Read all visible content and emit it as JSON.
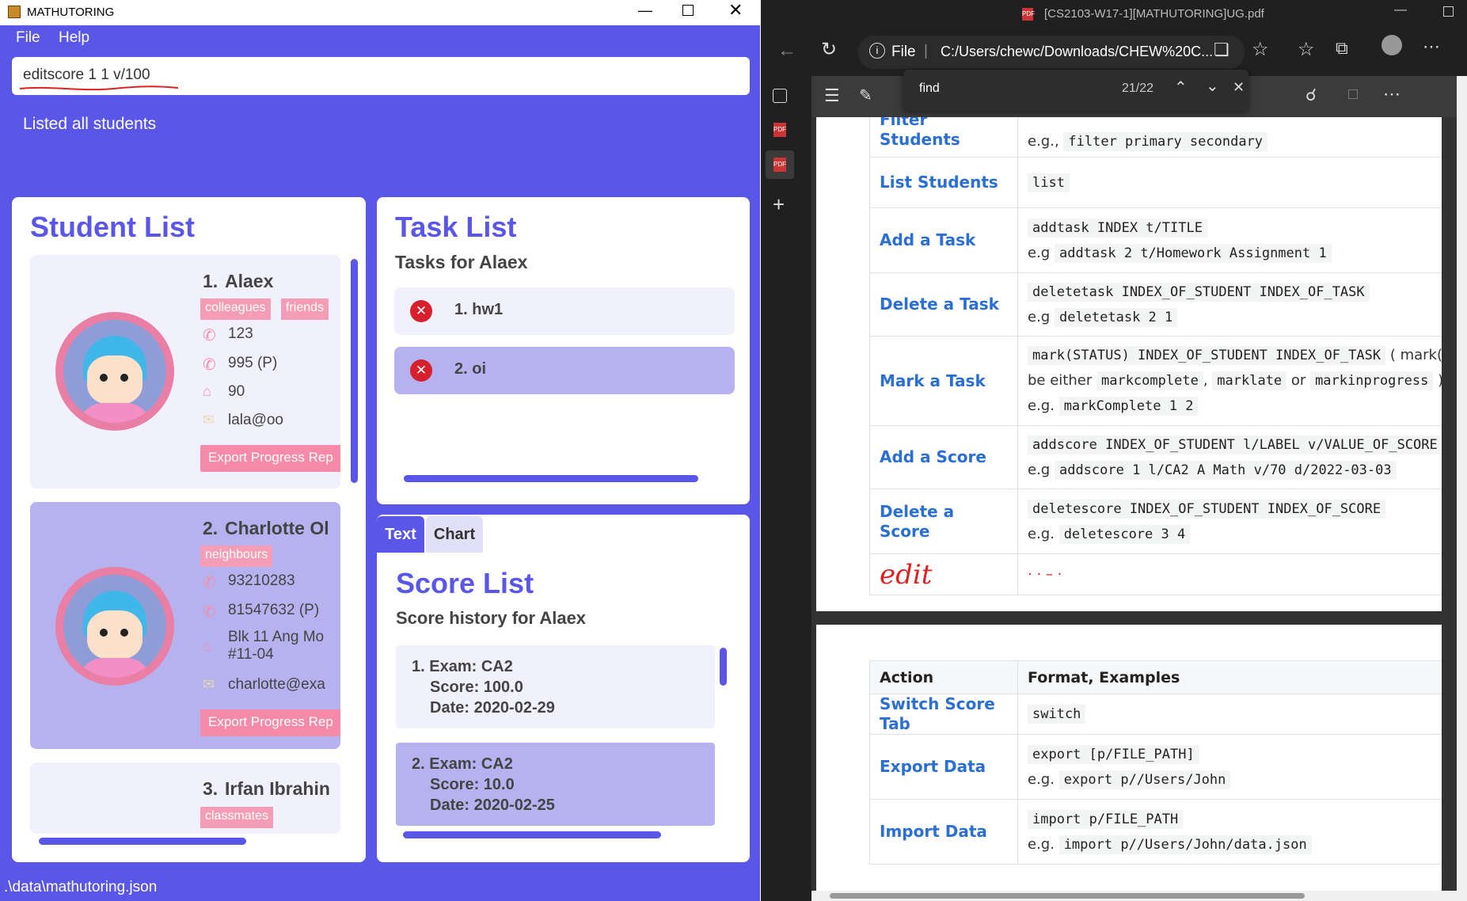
{
  "app": {
    "title": "MATHUTORING",
    "menu": {
      "file": "File",
      "help": "Help"
    },
    "command_input": "editscore 1 1 v/100",
    "result_message": "Listed all students",
    "status_path": ".\\data\\mathutoring.json"
  },
  "students": {
    "heading": "Student List",
    "items": [
      {
        "index": "1.",
        "name": "Alaex",
        "tags": [
          "colleagues",
          "friends"
        ],
        "phone": "123",
        "parent_phone": "995 (P)",
        "address": "90",
        "email": "lala@oo",
        "export_label": "Export Progress Rep"
      },
      {
        "index": "2.",
        "name": "Charlotte Ol",
        "tags": [
          "neighbours"
        ],
        "phone": "93210283",
        "parent_phone": "81547632 (P)",
        "address": "Blk 11 Ang Mo",
        "address2": "#11-04",
        "email": "charlotte@exa",
        "export_label": "Export Progress Rep"
      },
      {
        "index": "3.",
        "name": "Irfan Ibrahin",
        "tags": [
          "classmates"
        ]
      }
    ]
  },
  "tasks": {
    "heading": "Task List",
    "subheading": "Tasks for Alaex",
    "items": [
      {
        "label": "1. hw1"
      },
      {
        "label": "2. oi"
      }
    ]
  },
  "scores": {
    "tabs": {
      "text": "Text",
      "chart": "Chart"
    },
    "heading": "Score List",
    "subheading": "Score history for Alaex",
    "items": [
      {
        "exam": "1. Exam: CA2",
        "score": "Score: 100.0",
        "date": "Date: 2020-02-29"
      },
      {
        "exam": "2. Exam: CA2",
        "score": "Score: 10.0",
        "date": "Date: 2020-02-25"
      }
    ]
  },
  "browser": {
    "window_title": "[CS2103-W17-1][MATHUTORING]UG.pdf",
    "address_label": "File",
    "address": "C:/Users/chewc/Downloads/CHEW%20C...",
    "find_query": "find",
    "find_count": "21/22",
    "handwritten_note": "edit",
    "table_top": [
      {
        "action": "Filter Students",
        "lines": [
          [
            "e.g.,",
            "filter primary secondary"
          ]
        ]
      },
      {
        "action": "List Students",
        "lines": [
          [
            "",
            "list"
          ]
        ]
      },
      {
        "action": "Add a Task",
        "lines": [
          [
            "",
            "addtask INDEX t/TITLE"
          ],
          [
            "e.g",
            "addtask 2 t/Homework Assignment 1"
          ]
        ]
      },
      {
        "action": "Delete a Task",
        "lines": [
          [
            "",
            "deletetask INDEX_OF_STUDENT INDEX_OF_TASK"
          ],
          [
            "e.g",
            "deletetask 2 1"
          ]
        ]
      },
      {
        "action": "Mark a Task",
        "lines": [
          [
            "",
            "mark(STATUS) INDEX_OF_STUDENT INDEX_OF_TASK"
          ],
          [
            "be either",
            "markcomplete"
          ],
          [
            "e.g.",
            "markComplete 1 2"
          ]
        ]
      },
      {
        "action": "Add a Score",
        "lines": [
          [
            "",
            "addscore INDEX_OF_STUDENT l/LABEL v/VALUE_OF_SCORE"
          ],
          [
            "e.g",
            "addscore 1 l/CA2 A Math v/70 d/2022-03-03"
          ]
        ]
      },
      {
        "action": "Delete a Score",
        "lines": [
          [
            "",
            "deletescore INDEX_OF_STUDENT INDEX_OF_SCORE"
          ],
          [
            "e.g.",
            "deletescore 3 4"
          ]
        ]
      }
    ],
    "mark_extra": {
      "open": "( mark(",
      "sep": ",",
      "mid": "marklate",
      "or": "or",
      "last": "markinprogress",
      "close": ")"
    },
    "table_bottom_header": {
      "action": "Action",
      "format": "Format, Examples"
    },
    "table_bottom": [
      {
        "action": "Switch Score Tab",
        "lines": [
          [
            "",
            "switch"
          ]
        ]
      },
      {
        "action": "Export Data",
        "lines": [
          [
            "",
            "export [p/FILE_PATH]"
          ],
          [
            "e.g.",
            "export p//Users/John"
          ]
        ]
      },
      {
        "action": "Import Data",
        "lines": [
          [
            "",
            "import p/FILE_PATH"
          ],
          [
            "e.g.",
            "import p//Users/John/data.json"
          ]
        ]
      }
    ]
  },
  "colors": {
    "accent": "#5a57e8",
    "pink": "#f59db7",
    "link": "#2a6fd1",
    "selected": "#b5b2ef"
  }
}
